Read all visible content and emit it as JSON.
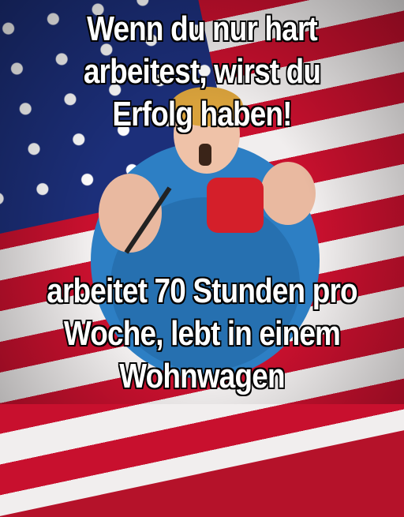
{
  "meme": {
    "top_lines": [
      "Wenn du nur hart",
      "arbeitest, wirst du",
      "Erfolg haben!"
    ],
    "bottom_lines": [
      "arbeitet 70 Stunden pro",
      "Woche, lebt in einem",
      "Wohnwagen"
    ]
  },
  "colors": {
    "flag_red": "#c8102e",
    "flag_white": "#f1eeee",
    "flag_blue": "#1c2f7a",
    "shirt_blue": "#2d7fc4",
    "bag_red": "#d41f2a"
  }
}
